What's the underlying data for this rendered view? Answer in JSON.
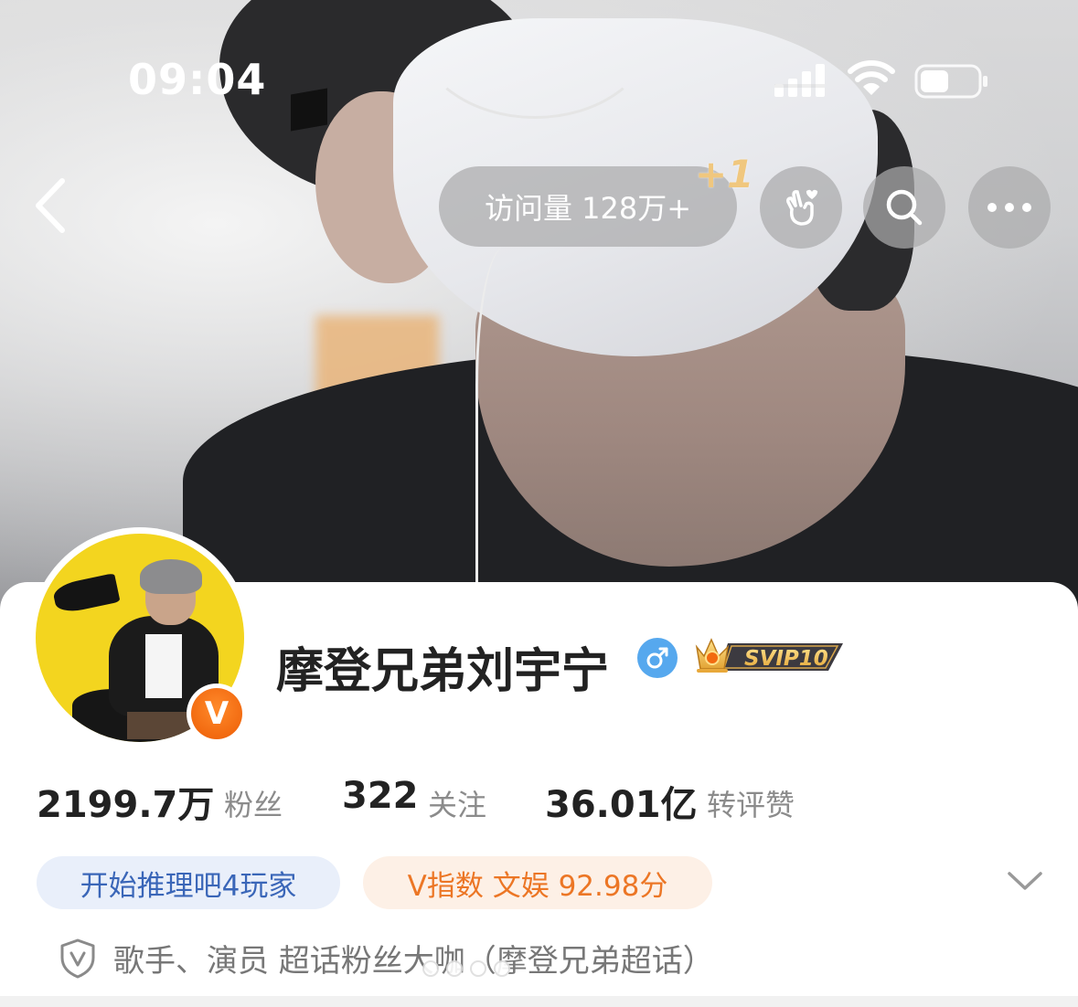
{
  "status_bar": {
    "time": "09:04"
  },
  "nav": {
    "back_icon": "chevron-left-icon",
    "visits_label": "访问量 128万+",
    "plus_one": "+1",
    "actions": [
      "heart-hand-icon",
      "search-icon",
      "more-icon"
    ]
  },
  "profile": {
    "username": "摩登兄弟刘宇宁",
    "gender": "♂",
    "svip": "SVIP10",
    "verified_badge": "V",
    "stats": [
      {
        "value": "2199.7万",
        "label": "粉丝"
      },
      {
        "value": "322",
        "label": "关注"
      },
      {
        "value": "36.01亿",
        "label": "转评赞"
      }
    ],
    "tags": {
      "game": "开始推理吧4玩家",
      "v_index": "V指数 文娱 92.98分"
    },
    "verification": "歌手、演员 超话粉丝大咖（摩登兄弟超话）"
  },
  "colors": {
    "accent_blue": "#3a66b8",
    "accent_orange": "#ec7625",
    "gender_blue": "#56a8ee",
    "verified_orange": "#f26a10"
  }
}
